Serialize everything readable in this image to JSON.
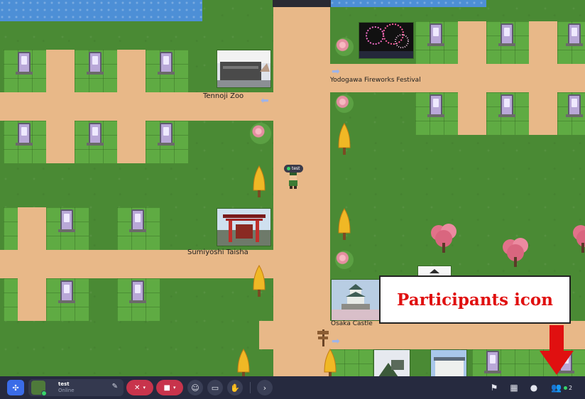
{
  "map": {
    "locations": [
      {
        "name": "Tennoji Zoo"
      },
      {
        "name": "Yodogawa Fireworks Festival"
      },
      {
        "name": "Sumiyoshi Taisha"
      },
      {
        "name": "Osaka Castle"
      }
    ],
    "player": {
      "name": "test"
    }
  },
  "callout": {
    "text": "Participants icon",
    "color": "#e01010"
  },
  "toolbar": {
    "user_name": "test",
    "user_status": "Online",
    "participant_count": "2",
    "accent": "#3a6ce8",
    "mute_color": "#c8344c"
  }
}
